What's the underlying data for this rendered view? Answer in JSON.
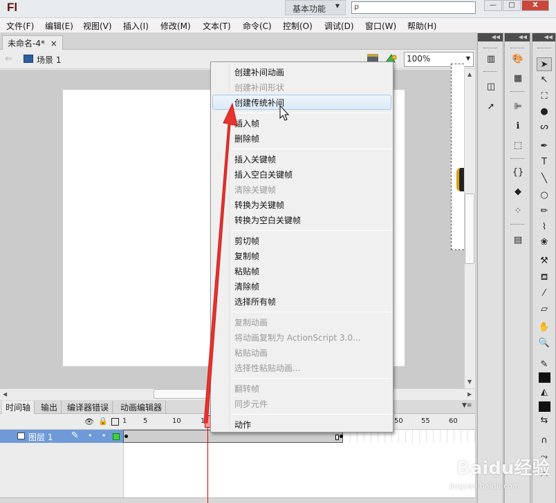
{
  "app": {
    "logo": "Fl",
    "workspace": "基本功能",
    "search_value": "ρ",
    "window_controls": [
      "—",
      "□",
      "X"
    ]
  },
  "menubar": {
    "items": [
      "文件(F)",
      "编辑(E)",
      "视图(V)",
      "插入(I)",
      "修改(M)",
      "文本(T)",
      "命令(C)",
      "控制(O)",
      "调试(D)",
      "窗口(W)",
      "帮助(H)"
    ]
  },
  "document": {
    "tab_title": "未命名-4*",
    "tab_close": "×",
    "scene_label": "场景 1",
    "zoom": "100%"
  },
  "context_menu": {
    "items": [
      {
        "label": "创建补间动画",
        "enabled": true
      },
      {
        "label": "创建补间形状",
        "enabled": false
      },
      {
        "label": "创建传统补间",
        "enabled": true,
        "highlighted": true
      },
      {
        "label": "插入帧",
        "enabled": true
      },
      {
        "label": "删除帧",
        "enabled": true
      },
      {
        "label": "插入关键帧",
        "enabled": true
      },
      {
        "label": "插入空白关键帧",
        "enabled": true
      },
      {
        "label": "清除关键帧",
        "enabled": false
      },
      {
        "label": "转换为关键帧",
        "enabled": true
      },
      {
        "label": "转换为空白关键帧",
        "enabled": true
      },
      {
        "label": "剪切帧",
        "enabled": true
      },
      {
        "label": "复制帧",
        "enabled": true
      },
      {
        "label": "粘贴帧",
        "enabled": true
      },
      {
        "label": "清除帧",
        "enabled": true
      },
      {
        "label": "选择所有帧",
        "enabled": true
      },
      {
        "label": "复制动画",
        "enabled": false
      },
      {
        "label": "将动画复制为 ActionScript 3.0...",
        "enabled": false
      },
      {
        "label": "粘贴动画",
        "enabled": false
      },
      {
        "label": "选择性粘贴动画...",
        "enabled": false
      },
      {
        "label": "翻转帧",
        "enabled": false
      },
      {
        "label": "同步元件",
        "enabled": false
      },
      {
        "label": "动作",
        "enabled": true
      }
    ]
  },
  "timeline": {
    "tabs": [
      "时间轴",
      "输出",
      "编译器错误",
      "动画编辑器"
    ],
    "frame_numbers": [
      "1",
      "5",
      "10",
      "15",
      "50",
      "55",
      "60"
    ],
    "layer_name": "图层 1",
    "layer_color": "#3ed43e",
    "playhead_frame": 15,
    "tween_end_frame": 40
  },
  "watermark": {
    "brand": "Baidu经验",
    "url": "jingyan.baidu.com"
  },
  "colors": {
    "annotation_arrow": "#e8332f",
    "layer_highlight": "#6f9ad8",
    "menu_highlight_border": "#a9c7ec"
  }
}
